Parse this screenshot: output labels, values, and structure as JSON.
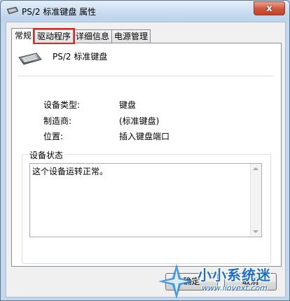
{
  "window": {
    "title": "PS/2 标准键盘 属性",
    "close_glyph": "x"
  },
  "tabs": [
    {
      "label": "常规",
      "active": true
    },
    {
      "label": "驱动程序",
      "highlighted": true
    },
    {
      "label": "详细信息"
    },
    {
      "label": "电源管理"
    }
  ],
  "device": {
    "name": "PS/2 标准键盘",
    "icon": "keyboard-icon"
  },
  "properties": [
    {
      "label": "设备类型:",
      "value": "键盘"
    },
    {
      "label": "制造商:",
      "value": "(标准键盘)"
    },
    {
      "label": "位置:",
      "value": "插入键盘端口"
    }
  ],
  "status": {
    "legend": "设备状态",
    "text": "这个设备运转正常。"
  },
  "buttons": {
    "ok_label": "确定",
    "cancel_label": "取消"
  },
  "watermark": {
    "line1": "小小系统迷",
    "line2": "www.iiovext.com"
  },
  "colors": {
    "highlight": "#e0281f",
    "accent": "#1f6fc7"
  }
}
